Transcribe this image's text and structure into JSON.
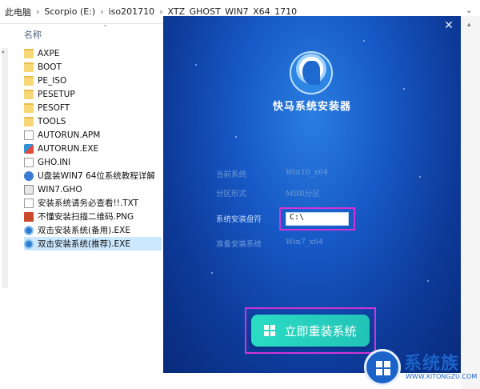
{
  "breadcrumb": [
    "此电脑",
    "Scorpio (E:)",
    "iso201710",
    "XTZ_GHOST_WIN7_X64_1710"
  ],
  "file_list": {
    "column_header": "名称",
    "items": [
      {
        "name": "AXPE",
        "icon": "folder-icon"
      },
      {
        "name": "BOOT",
        "icon": "folder-icon"
      },
      {
        "name": "PE_ISO",
        "icon": "folder-icon"
      },
      {
        "name": "PESETUP",
        "icon": "folder-icon"
      },
      {
        "name": "PESOFT",
        "icon": "folder-icon"
      },
      {
        "name": "TOOLS",
        "icon": "folder-icon"
      },
      {
        "name": "AUTORUN.APM",
        "icon": "file-icon"
      },
      {
        "name": "AUTORUN.EXE",
        "icon": "exe-icon"
      },
      {
        "name": "GHO.INI",
        "icon": "ini-file-icon"
      },
      {
        "name": "U盘装WIN7 64位系统教程详解",
        "icon": "usb-icon"
      },
      {
        "name": "WIN7.GHO",
        "icon": "gho-file-icon"
      },
      {
        "name": "安装系统请务必查看!!.TXT",
        "icon": "text-file-icon"
      },
      {
        "name": "不懂安装扫描二维码.PNG",
        "icon": "image-file-icon"
      },
      {
        "name": "双击安装系统(备用).EXE",
        "icon": "installer-icon"
      },
      {
        "name": "双击安装系统(推荐).EXE",
        "icon": "installer-icon",
        "selected": true
      }
    ]
  },
  "installer": {
    "title": "快马系统安装器",
    "current_system_label": "当前系统",
    "current_system_value": "Win10_x64",
    "partition_label": "分区形式",
    "partition_value": "MBR分区",
    "drive_label": "系统安装盘符",
    "drive_value": "C:\\",
    "prepare_label": "准备安装系统",
    "prepare_value": "Win7_x64",
    "install_button": "立即重装系统",
    "close_symbol": "✕"
  },
  "watermark": {
    "text": "系统族",
    "url": "WWW.XITONGZU.COM"
  },
  "colors": {
    "installer_bg": "#1759c6",
    "install_button": "#2bdcc4",
    "highlight_border": "#d433d6",
    "selected_row": "#cce8ff"
  }
}
